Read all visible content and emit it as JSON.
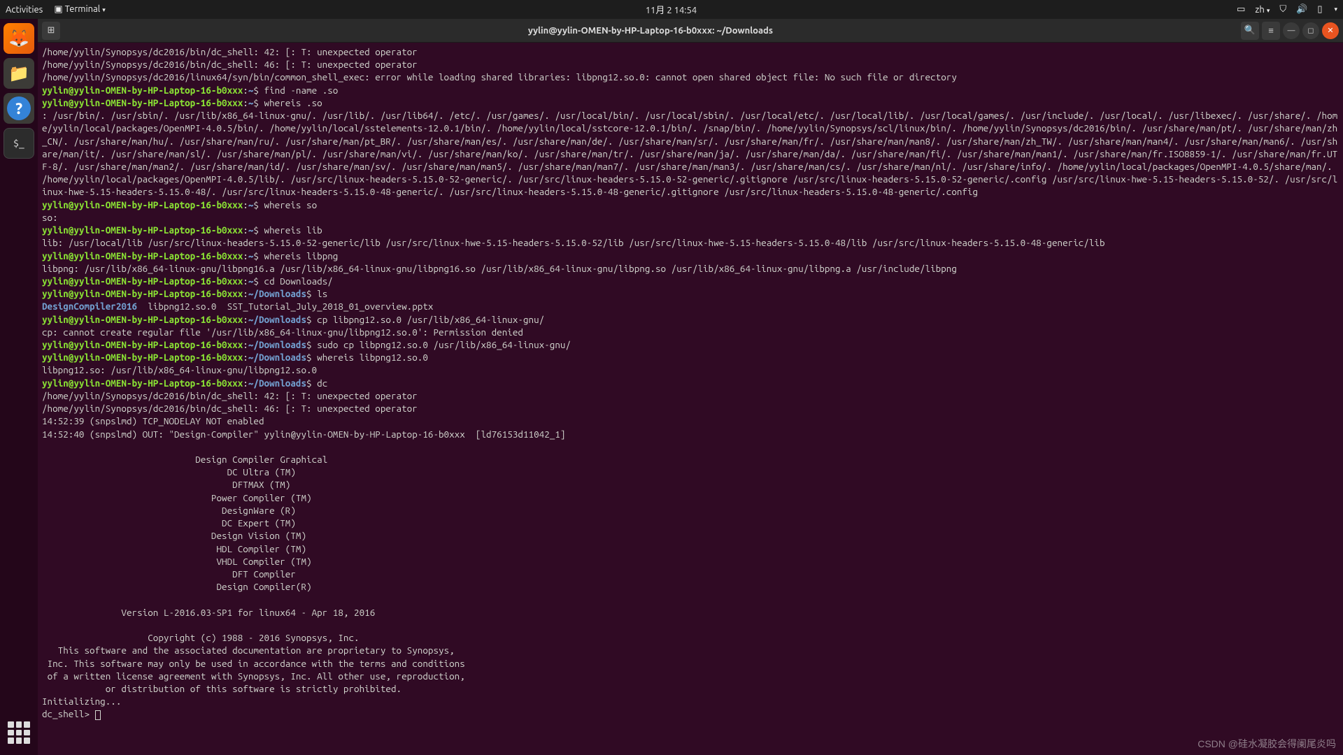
{
  "topbar": {
    "activities": "Activities",
    "app_menu": "Terminal",
    "clock": "11月 2  14:54",
    "lang": "zh"
  },
  "dock": {
    "items": [
      "firefox",
      "files",
      "help",
      "terminal"
    ]
  },
  "window": {
    "title": "yylin@yylin-OMEN-by-HP-Laptop-16-b0xxx: ~/Downloads"
  },
  "prompt": {
    "userhost": "yylin@yylin-OMEN-by-HP-Laptop-16-b0xxx",
    "home": "~",
    "downloads": "~/Downloads"
  },
  "lines": {
    "err1": "/home/yylin/Synopsys/dc2016/bin/dc_shell: 42: [: T: unexpected operator",
    "err2": "/home/yylin/Synopsys/dc2016/bin/dc_shell: 46: [: T: unexpected operator",
    "err3": "/home/yylin/Synopsys/dc2016/linux64/syn/bin/common_shell_exec: error while loading shared libraries: libpng12.so.0: cannot open shared object file: No such file or directory",
    "cmd_find": "find -name .so",
    "cmd_whereis_so_dot": "whereis .so",
    "whereis_so_out": ": /usr/bin/. /usr/sbin/. /usr/lib/x86_64-linux-gnu/. /usr/lib/. /usr/lib64/. /etc/. /usr/games/. /usr/local/bin/. /usr/local/sbin/. /usr/local/etc/. /usr/local/lib/. /usr/local/games/. /usr/include/. /usr/local/. /usr/libexec/. /usr/share/. /home/yylin/local/packages/OpenMPI-4.0.5/bin/. /home/yylin/local/sstelements-12.0.1/bin/. /home/yylin/local/sstcore-12.0.1/bin/. /snap/bin/. /home/yylin/Synopsys/scl/linux/bin/. /home/yylin/Synopsys/dc2016/bin/. /usr/share/man/pt/. /usr/share/man/zh_CN/. /usr/share/man/hu/. /usr/share/man/ru/. /usr/share/man/pt_BR/. /usr/share/man/es/. /usr/share/man/de/. /usr/share/man/sr/. /usr/share/man/fr/. /usr/share/man/man8/. /usr/share/man/zh_TW/. /usr/share/man/man4/. /usr/share/man/man6/. /usr/share/man/it/. /usr/share/man/sl/. /usr/share/man/pl/. /usr/share/man/vi/. /usr/share/man/ko/. /usr/share/man/tr/. /usr/share/man/ja/. /usr/share/man/da/. /usr/share/man/fi/. /usr/share/man/man1/. /usr/share/man/fr.ISO8859-1/. /usr/share/man/fr.UTF-8/. /usr/share/man/man2/. /usr/share/man/id/. /usr/share/man/sv/. /usr/share/man/man5/. /usr/share/man/man7/. /usr/share/man/man3/. /usr/share/man/cs/. /usr/share/man/nl/. /usr/share/info/. /home/yylin/local/packages/OpenMPI-4.0.5/share/man/. /home/yylin/local/packages/OpenMPI-4.0.5/lib/. /usr/src/linux-headers-5.15.0-52-generic/. /usr/src/linux-headers-5.15.0-52-generic/.gitignore /usr/src/linux-headers-5.15.0-52-generic/.config /usr/src/linux-hwe-5.15-headers-5.15.0-52/. /usr/src/linux-hwe-5.15-headers-5.15.0-48/. /usr/src/linux-headers-5.15.0-48-generic/. /usr/src/linux-headers-5.15.0-48-generic/.gitignore /usr/src/linux-headers-5.15.0-48-generic/.config",
    "cmd_whereis_so": "whereis so",
    "so_out": "so:",
    "cmd_whereis_lib": "whereis lib",
    "lib_out": "lib: /usr/local/lib /usr/src/linux-headers-5.15.0-52-generic/lib /usr/src/linux-hwe-5.15-headers-5.15.0-52/lib /usr/src/linux-hwe-5.15-headers-5.15.0-48/lib /usr/src/linux-headers-5.15.0-48-generic/lib",
    "cmd_whereis_libpng": "whereis libpng",
    "libpng_out": "libpng: /usr/lib/x86_64-linux-gnu/libpng16.a /usr/lib/x86_64-linux-gnu/libpng16.so /usr/lib/x86_64-linux-gnu/libpng.so /usr/lib/x86_64-linux-gnu/libpng.a /usr/include/libpng",
    "cmd_cd": "cd Downloads/",
    "cmd_ls": "ls",
    "ls_dir": "DesignCompiler2016",
    "ls_rest": "  libpng12.so.0  SST_Tutorial_July_2018_01_overview.pptx",
    "cmd_cp": "cp libpng12.so.0 /usr/lib/x86_64-linux-gnu/",
    "cp_err": "cp: cannot create regular file '/usr/lib/x86_64-linux-gnu/libpng12.so.0': Permission denied",
    "cmd_sudo_cp": "sudo cp libpng12.so.0 /usr/lib/x86_64-linux-gnu/",
    "cmd_whereis_libpng12": "whereis libpng12.so.0",
    "libpng12_out": "libpng12.so: /usr/lib/x86_64-linux-gnu/libpng12.so.0",
    "cmd_dc": "dc",
    "dc_err1": "/home/yylin/Synopsys/dc2016/bin/dc_shell: 42: [: T: unexpected operator",
    "dc_err2": "/home/yylin/Synopsys/dc2016/bin/dc_shell: 46: [: T: unexpected operator",
    "dc_l1": "14:52:39 (snpslmd) TCP_NODELAY NOT enabled",
    "dc_l2": "14:52:40 (snpslmd) OUT: \"Design-Compiler\" yylin@yylin-OMEN-by-HP-Laptop-16-b0xxx  [ld76153d11042_1]",
    "banner1": "                             Design Compiler Graphical",
    "banner2": "                                   DC Ultra (TM)",
    "banner3": "                                    DFTMAX (TM)",
    "banner4": "                                Power Compiler (TM)",
    "banner5": "                                  DesignWare (R)",
    "banner6": "                                  DC Expert (TM)",
    "banner7": "                                Design Vision (TM)",
    "banner8": "                                 HDL Compiler (TM)",
    "banner9": "                                 VHDL Compiler (TM)",
    "banner10": "                                    DFT Compiler",
    "banner11": "                                 Design Compiler(R)",
    "version": "               Version L-2016.03-SP1 for linux64 - Apr 18, 2016",
    "copy": "                    Copyright (c) 1988 - 2016 Synopsys, Inc.",
    "leg1": "   This software and the associated documentation are proprietary to Synopsys,",
    "leg2": " Inc. This software may only be used in accordance with the terms and conditions",
    "leg3": " of a written license agreement with Synopsys, Inc. All other use, reproduction,",
    "leg4": "            or distribution of this software is strictly prohibited.",
    "init": "Initializing...",
    "dcshell": "dc_shell> "
  },
  "watermark": "CSDN @硅水凝胶会得阑尾炎吗"
}
